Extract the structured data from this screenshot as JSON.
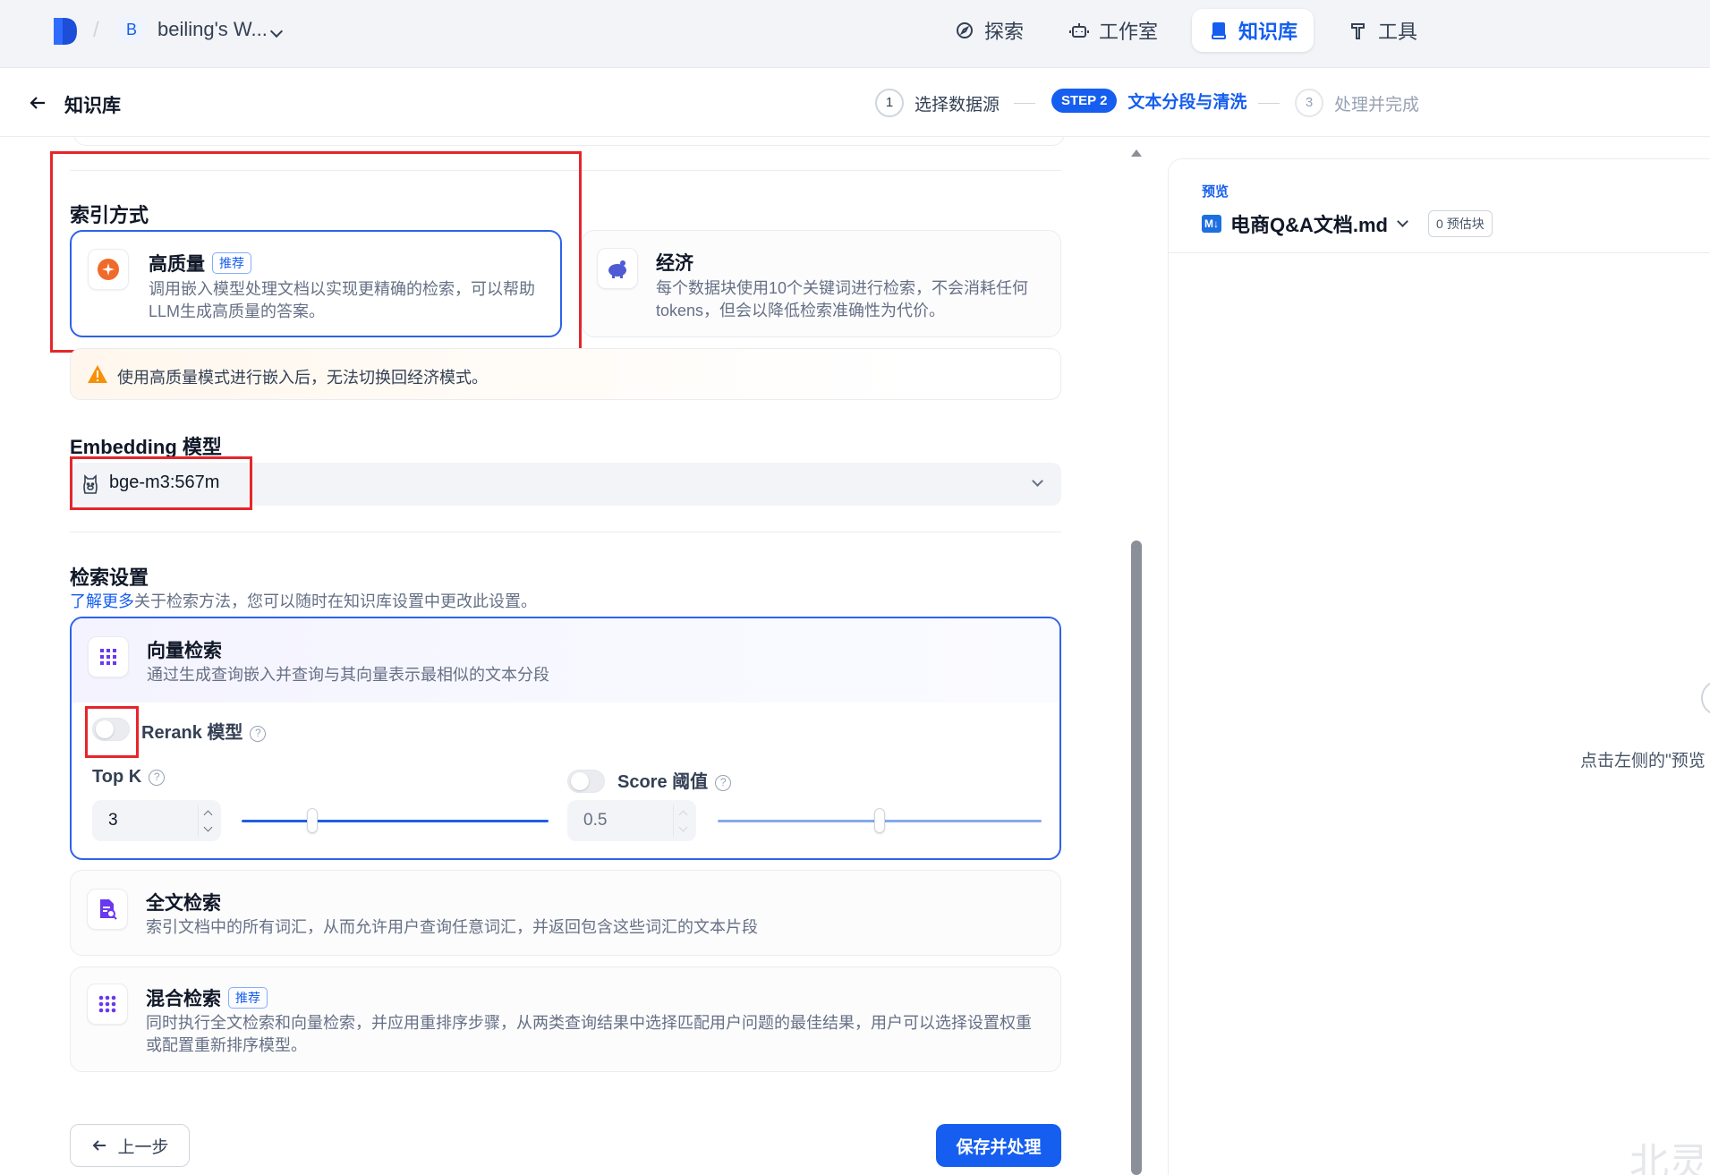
{
  "nav": {
    "workspace_initial": "B",
    "workspace_name": "beiling's W...",
    "tabs": [
      {
        "label": "探索",
        "icon": "compass-icon"
      },
      {
        "label": "工作室",
        "icon": "robot-icon"
      },
      {
        "label": "知识库",
        "icon": "book-icon",
        "active": true
      },
      {
        "label": "工具",
        "icon": "hammer-icon"
      }
    ],
    "accent_color": "#155eef"
  },
  "header": {
    "title": "知识库",
    "steps": [
      {
        "num": "1",
        "label": "选择数据源"
      },
      {
        "num": "STEP 2",
        "label": "文本分段与清洗"
      },
      {
        "num": "3",
        "label": "处理并完成"
      }
    ]
  },
  "index": {
    "title": "索引方式",
    "high": {
      "title": "高质量",
      "tag": "推荐",
      "desc": "调用嵌入模型处理文档以实现更精确的检索，可以帮助LLM生成高质量的答案。"
    },
    "eco": {
      "title": "经济",
      "desc": "每个数据块使用10个关键词进行检索，不会消耗任何tokens，但会以降低检索准确性为代价。"
    },
    "warning": "使用高质量模式进行嵌入后，无法切换回经济模式。"
  },
  "embedding": {
    "title": "Embedding 模型",
    "value": "bge-m3:567m"
  },
  "retrieval": {
    "title": "检索设置",
    "learn_more": "了解更多",
    "hint": "关于检索方法，您可以随时在知识库设置中更改此设置。",
    "vector": {
      "title": "向量检索",
      "desc": "通过生成查询嵌入并查询与其向量表示最相似的文本分段"
    },
    "rerank_label": "Rerank 模型",
    "topk_label": "Top K",
    "topk_value": "3",
    "topk_fraction": 0.23,
    "score_label": "Score 阈值",
    "score_value": "0.5",
    "score_fraction": 0.5,
    "fulltext": {
      "title": "全文检索",
      "desc": "索引文档中的所有词汇，从而允许用户查询任意词汇，并返回包含这些词汇的文本片段"
    },
    "hybrid": {
      "title": "混合检索",
      "tag": "推荐",
      "desc": "同时执行全文检索和向量检索，并应用重排序步骤，从两类查询结果中选择匹配用户问题的最佳结果，用户可以选择设置权重或配置重新排序模型。"
    }
  },
  "buttons": {
    "prev": "上一步",
    "save": "保存并处理"
  },
  "preview": {
    "label": "预览",
    "file_name": "电商Q&A文档.md",
    "chunk_badge": "0 预估块",
    "empty_hint": "点击左侧的\"预览",
    "md_badge": "M↓"
  },
  "watermark": "北灵"
}
